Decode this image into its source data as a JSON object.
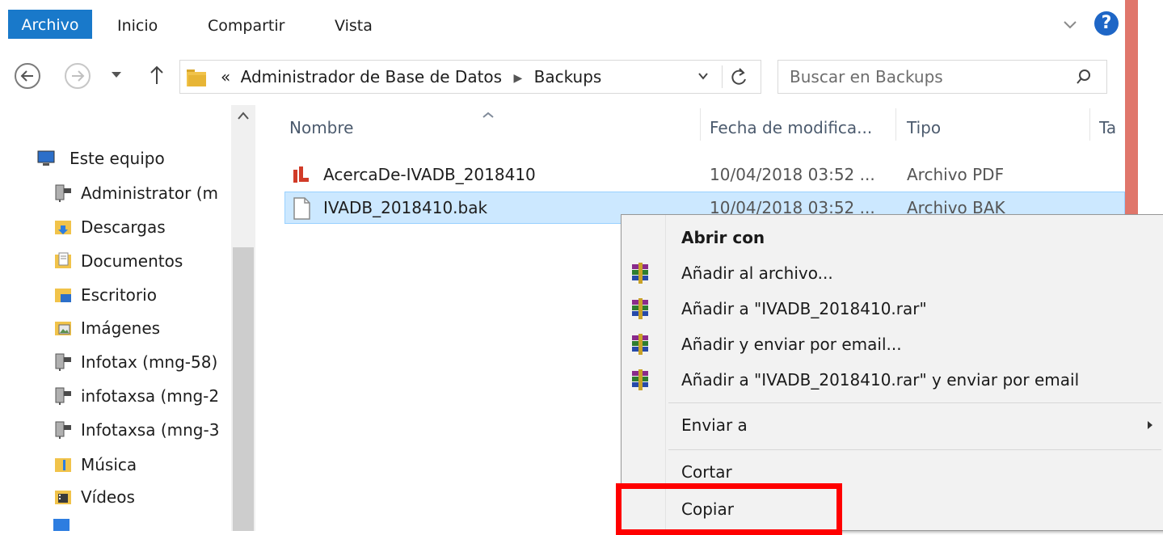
{
  "ribbon": {
    "tabs": [
      "Archivo",
      "Inicio",
      "Compartir",
      "Vista"
    ],
    "help_label": "?"
  },
  "address": {
    "overflow_glyph": "«",
    "path": [
      "Administrador de Base de Datos",
      "Backups"
    ]
  },
  "search": {
    "placeholder": "Buscar en Backups"
  },
  "nav_pane": {
    "root": "Este equipo",
    "items": [
      {
        "label": "Administrator (m",
        "icon": "network-drive-icon"
      },
      {
        "label": "Descargas",
        "icon": "downloads-folder-icon"
      },
      {
        "label": "Documentos",
        "icon": "documents-folder-icon"
      },
      {
        "label": "Escritorio",
        "icon": "desktop-folder-icon"
      },
      {
        "label": "Imágenes",
        "icon": "pictures-folder-icon"
      },
      {
        "label": "Infotax (mng-58)",
        "icon": "network-drive-icon"
      },
      {
        "label": "infotaxsa (mng-2",
        "icon": "network-drive-icon"
      },
      {
        "label": "Infotaxsa (mng-3",
        "icon": "network-drive-icon"
      },
      {
        "label": "Música",
        "icon": "music-folder-icon"
      },
      {
        "label": "Vídeos",
        "icon": "videos-folder-icon"
      }
    ]
  },
  "columns": [
    "Nombre",
    "Fecha de modifica...",
    "Tipo",
    "Ta"
  ],
  "files": [
    {
      "name": "AcercaDe-IVADB_2018410",
      "date": "10/04/2018 03:52 ...",
      "type": "Archivo PDF",
      "icon": "pdf-file-icon"
    },
    {
      "name": "IVADB_2018410.bak",
      "date": "10/04/2018 03:52 ...",
      "type": "Archivo BAK",
      "icon": "generic-file-icon"
    }
  ],
  "context_menu": {
    "items": [
      {
        "label": "Abrir con",
        "bold": true,
        "icon": ""
      },
      {
        "label": "Añadir al archivo...",
        "icon": "winrar-icon"
      },
      {
        "label": "Añadir a \"IVADB_2018410.rar\"",
        "icon": "winrar-icon"
      },
      {
        "label": "Añadir y enviar por email...",
        "icon": "winrar-icon"
      },
      {
        "label": "Añadir a \"IVADB_2018410.rar\" y enviar por email",
        "icon": "winrar-icon"
      },
      {
        "label": "Enviar a",
        "icon": "",
        "submenu": true
      },
      {
        "label": "Cortar",
        "icon": ""
      },
      {
        "label": "Copiar",
        "icon": ""
      }
    ]
  },
  "colors": {
    "accent": "#1979ca",
    "selection": "#cce8ff",
    "highlight_box": "#ff0000",
    "window_edge": "#e0766b"
  }
}
